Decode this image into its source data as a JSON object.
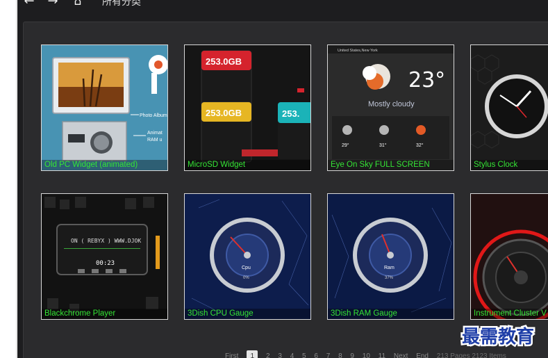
{
  "toolbar": {
    "back_icon": "arrow-left-icon",
    "forward_icon": "arrow-right-icon",
    "home_icon": "home-icon",
    "breadcrumb": "所有分类"
  },
  "gallery": {
    "items": [
      {
        "title": "Old PC Widget (animated)",
        "preview_labels": [
          "Photo Album",
          "Animat",
          "RAM u"
        ]
      },
      {
        "title": "MicroSD Widget",
        "preview_labels": [
          "253.0GB",
          "253.0GB",
          "253."
        ]
      },
      {
        "title": "Eye On Sky FULL SCREEN",
        "preview_labels": [
          "United States,New York",
          "23°",
          "Mostly cloudy",
          "29°",
          "31°",
          "32°"
        ]
      },
      {
        "title": "Stylus Clock",
        "preview_labels": []
      },
      {
        "title": "Blackchrome Player",
        "preview_labels": [
          "ON ( REBYX ) WWW.DJOK",
          "00:23"
        ]
      },
      {
        "title": "3Dish CPU Gauge",
        "preview_labels": [
          "Cpu",
          "0%"
        ]
      },
      {
        "title": "3Dish RAM Gauge",
        "preview_labels": [
          "Ram",
          "37%"
        ]
      },
      {
        "title": "Instrument Cluster V",
        "preview_labels": []
      }
    ]
  },
  "pagination": {
    "first": "First",
    "pages": [
      "1",
      "2",
      "3",
      "4",
      "5",
      "6",
      "7",
      "8",
      "9",
      "10",
      "11"
    ],
    "current": "1",
    "next": "Next",
    "end": "End",
    "info": "213 Pages 2123 Items"
  },
  "watermark": {
    "text": "最需教育"
  },
  "colors": {
    "app_bg": "#1d1d1f",
    "panel_bg": "#2b2b2d",
    "caption": "#35e535",
    "watermark": "#1f3fa8"
  }
}
